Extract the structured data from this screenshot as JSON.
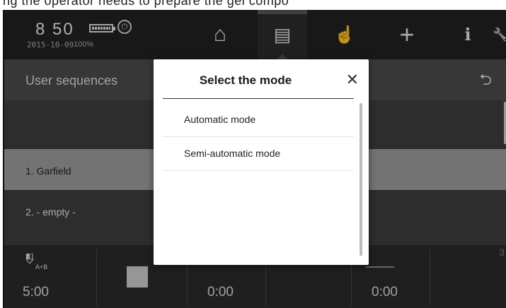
{
  "top_strip": {
    "text": "ng the operator needs to prepare the gel compo"
  },
  "status": {
    "time": "8 50",
    "date": "2015-10-09",
    "battery_pct": "100%"
  },
  "nav": {
    "items": [
      {
        "name": "home-icon",
        "glyph": "⌂"
      },
      {
        "name": "document-icon",
        "glyph": "▤"
      },
      {
        "name": "hand-pointer-icon",
        "glyph": "☝"
      },
      {
        "name": "add-icon",
        "glyph": "+"
      },
      {
        "name": "info-icon",
        "glyph": "ℹ"
      },
      {
        "name": "wrench-icon",
        "glyph": "🔧"
      }
    ]
  },
  "panel": {
    "title": "User sequences"
  },
  "list": {
    "items": [
      {
        "label": "1. Garfield"
      },
      {
        "label": "2. - empty -"
      }
    ]
  },
  "bottom": {
    "ab_label": "A+B",
    "time_main": "5:00",
    "time_2": "0:00",
    "time_3": "0:00",
    "three": "3"
  },
  "dialog": {
    "title": "Select the mode",
    "close_glyph": "✕",
    "options": [
      {
        "label": "Automatic mode"
      },
      {
        "label": "Semi-automatic mode"
      }
    ]
  }
}
